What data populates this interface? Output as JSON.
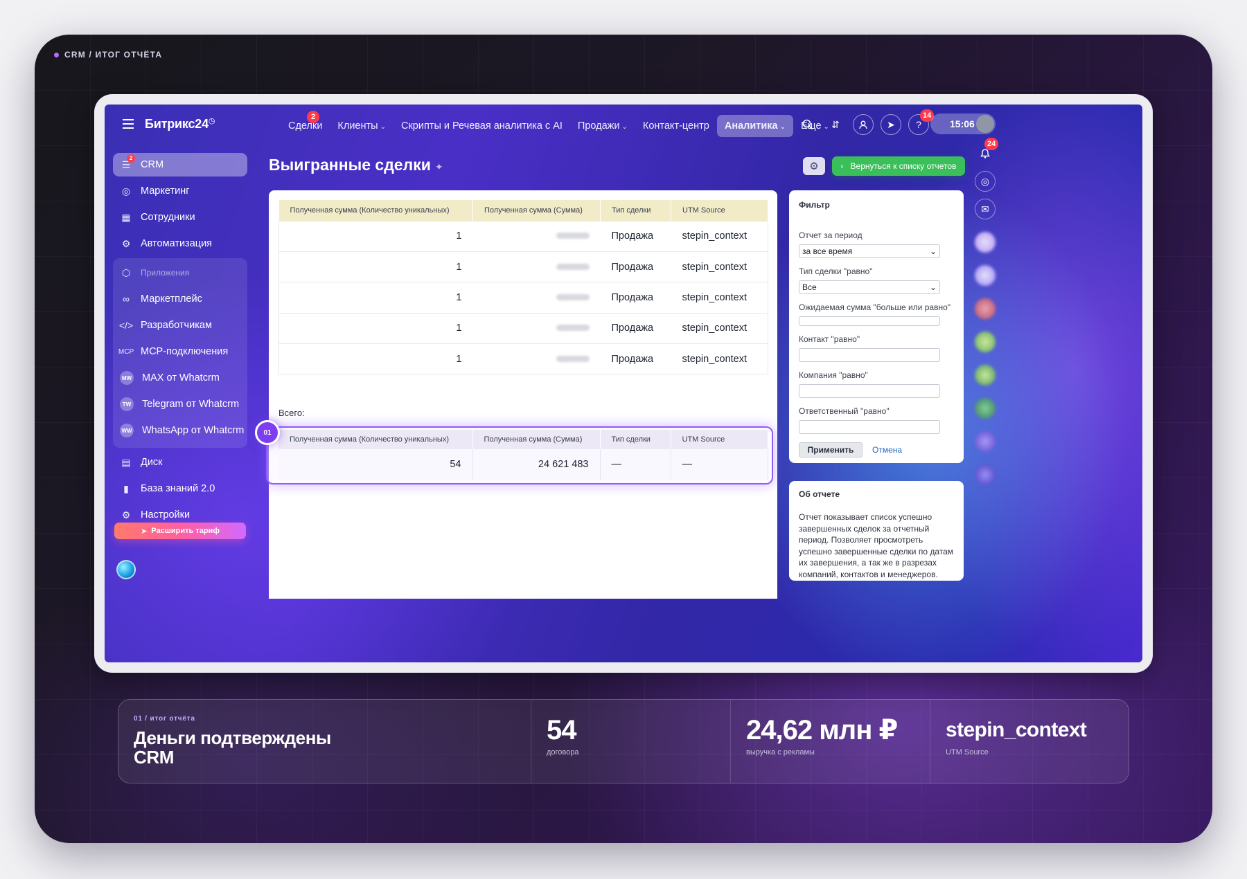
{
  "breadcrumb": "CRM / ИТОГ ОТЧЁТА",
  "app": {
    "logo": "Битрикс24",
    "nav": [
      {
        "label": "Сделки",
        "badge": "2",
        "dropdown": false,
        "active": false
      },
      {
        "label": "Клиенты",
        "dropdown": true,
        "active": false
      },
      {
        "label": "Скрипты и Речевая аналитика с AI",
        "dropdown": false,
        "active": false
      },
      {
        "label": "Продажи",
        "dropdown": true,
        "active": false
      },
      {
        "label": "Контакт-центр",
        "dropdown": false,
        "active": false
      },
      {
        "label": "Аналитика",
        "dropdown": true,
        "active": true
      },
      {
        "label": "Еще",
        "dropdown": true,
        "active": false
      }
    ],
    "help_badge": "14",
    "clock": "15:06",
    "notifications_badge": "24"
  },
  "sidebar": {
    "items": [
      {
        "label": "CRM",
        "icon": "crm-funnel-icon",
        "badge": "2"
      },
      {
        "label": "Маркетинг",
        "icon": "marketing-icon"
      },
      {
        "label": "Сотрудники",
        "icon": "employees-icon"
      },
      {
        "label": "Автоматизация",
        "icon": "automation-icon"
      }
    ],
    "apps_group": {
      "header": "Приложения",
      "items": [
        {
          "label": "Маркетплейс",
          "icon": "marketplace-icon"
        },
        {
          "label": "Разработчикам",
          "icon": "code-icon"
        },
        {
          "label": "MCP-подключения",
          "icon": "mcp-icon"
        },
        {
          "label": "MAX от Whatcrm",
          "avatar": "MW"
        },
        {
          "label": "Telegram от Whatcrm",
          "avatar": "TW"
        },
        {
          "label": "WhatsApp от Whatcrm",
          "avatar": "WW"
        }
      ]
    },
    "bottom_items": [
      {
        "label": "Диск",
        "icon": "disk-icon"
      },
      {
        "label": "База знаний 2.0",
        "icon": "knowledge-base-icon"
      },
      {
        "label": "Настройки",
        "icon": "settings-gear-icon"
      }
    ],
    "upgrade_label": "Расширить тариф"
  },
  "page": {
    "title": "Выигранные сделки",
    "back_button": "Вернуться к списку отчетов"
  },
  "report": {
    "columns": [
      "Полученная сумма (Количество уникальных)",
      "Полученная сумма (Сумма)",
      "Тип сделки",
      "UTM Source"
    ],
    "rows": [
      {
        "count": "1",
        "sum": "",
        "type": "Продажа",
        "utm": "stepin_context"
      },
      {
        "count": "1",
        "sum": "",
        "type": "Продажа",
        "utm": "stepin_context"
      },
      {
        "count": "1",
        "sum": "",
        "type": "Продажа",
        "utm": "stepin_context"
      },
      {
        "count": "1",
        "sum": "",
        "type": "Продажа",
        "utm": "stepin_context"
      },
      {
        "count": "1",
        "sum": "",
        "type": "Продажа",
        "utm": "stepin_context"
      }
    ],
    "total_label": "Всего:",
    "total": {
      "count": "54",
      "sum": "24 621 483",
      "type": "—",
      "utm": "—"
    },
    "step_marker": "01"
  },
  "filter": {
    "title": "Фильтр",
    "period_label": "Отчет за период",
    "period_value": "за все время",
    "deal_type_label": "Тип сделки \"равно\"",
    "deal_type_value": "Все",
    "expected_sum_label": "Ожидаемая сумма \"больше или равно\"",
    "contact_label": "Контакт \"равно\"",
    "company_label": "Компания \"равно\"",
    "responsible_label": "Ответственный \"равно\"",
    "apply_label": "Применить",
    "cancel_label": "Отмена"
  },
  "about": {
    "title": "Об отчете",
    "text": "Отчет показывает список успешно завершенных сделок за отчетный период. Позволяет просмотреть успешно завершенные сделки по датам их завершения, а так же в разрезах компаний, контактов и менеджеров."
  },
  "summary": {
    "kicker": "01 / итог отчёта",
    "title_line1": "Деньги подтверждены",
    "title_line2": "CRM",
    "deals_value": "54",
    "deals_caption": "договора",
    "revenue_value": "24,62 млн ₽",
    "revenue_caption": "выручка с рекламы",
    "source_value": "stepin_context",
    "source_caption": "UTM Source"
  },
  "colors": {
    "accent": "#8f5cff",
    "back_button": "#3bbf5a",
    "header_row": "#f1ecc7",
    "badge": "#ff3b4a"
  }
}
